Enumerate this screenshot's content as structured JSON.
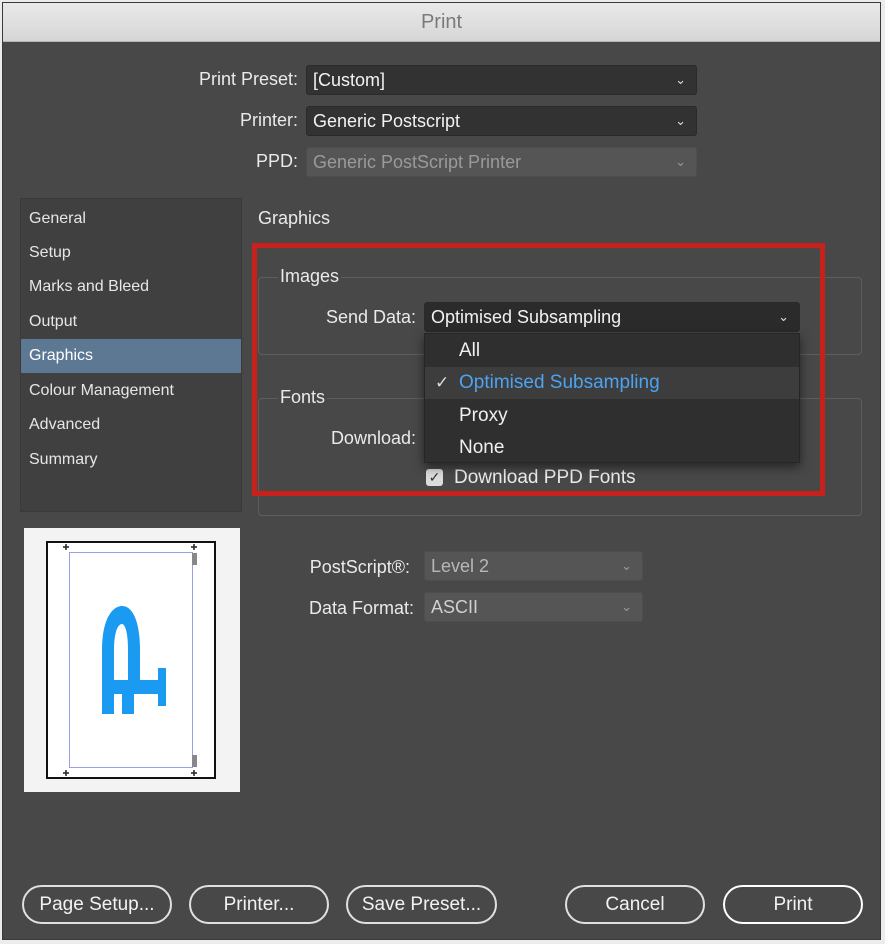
{
  "window": {
    "title": "Print"
  },
  "header": {
    "print_preset": {
      "label": "Print Preset:",
      "value": "[Custom]"
    },
    "printer": {
      "label": "Printer:",
      "value": "Generic Postscript"
    },
    "ppd": {
      "label": "PPD:",
      "value": "Generic PostScript Printer"
    }
  },
  "sidebar": {
    "items": [
      {
        "label": "General"
      },
      {
        "label": "Setup"
      },
      {
        "label": "Marks and Bleed"
      },
      {
        "label": "Output"
      },
      {
        "label": "Graphics",
        "active": true
      },
      {
        "label": "Colour Management"
      },
      {
        "label": "Advanced"
      },
      {
        "label": "Summary"
      }
    ]
  },
  "main": {
    "section_title": "Graphics",
    "images": {
      "legend": "Images",
      "send_data_label": "Send Data:",
      "send_data_value": "Optimised Subsampling",
      "dropdown_options": [
        "All",
        "Optimised Subsampling",
        "Proxy",
        "None"
      ],
      "selected_option": "Optimised Subsampling"
    },
    "fonts": {
      "legend": "Fonts",
      "download_label": "Download:",
      "download_ppd_fonts_label": "Download PPD Fonts",
      "download_ppd_fonts_checked": true
    },
    "postscript": {
      "label": "PostScript®:",
      "value": "Level 2"
    },
    "data_format": {
      "label": "Data Format:",
      "value": "ASCII"
    }
  },
  "buttons": {
    "page_setup": "Page Setup...",
    "printer": "Printer...",
    "save_preset": "Save Preset...",
    "cancel": "Cancel",
    "print": "Print"
  },
  "colors": {
    "accent": "#4da3f0",
    "highlight_border": "#c8201a",
    "sidebar_active": "#5c7893",
    "dialog_bg": "#484848"
  },
  "icons": {
    "dropdown": "chevron-down-icon",
    "checkmark": "checkmark-icon"
  }
}
